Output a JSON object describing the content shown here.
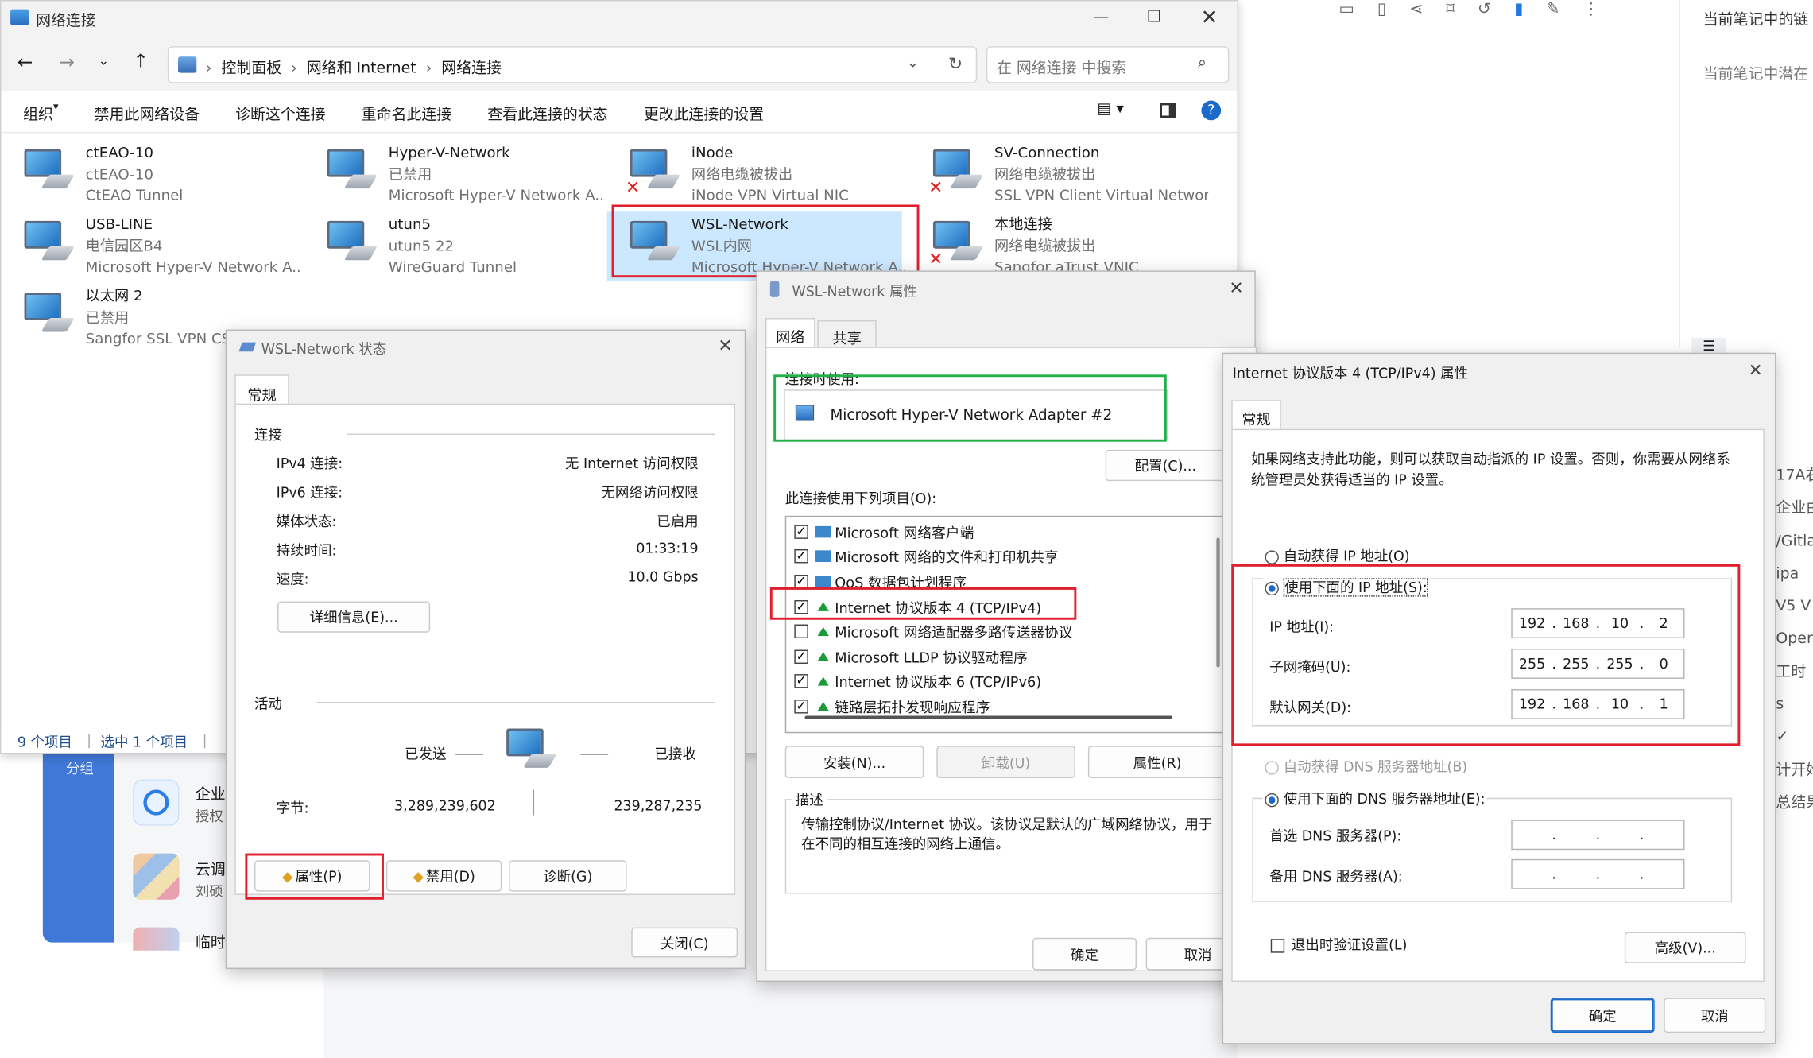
{
  "explorer": {
    "title": "网络连接",
    "breadcrumb": [
      "控制面板",
      "网络和 Internet",
      "网络连接"
    ],
    "search_placeholder": "在 网络连接 中搜索",
    "toolbar": [
      "组织",
      "禁用此网络设备",
      "诊断这个连接",
      "重命名此连接",
      "查看此连接的状态",
      "更改此连接的设置"
    ],
    "items": [
      {
        "name": "ctEAO-10",
        "status": "ctEAO-10",
        "device": "CtEAO Tunnel",
        "error": false
      },
      {
        "name": "Hyper-V-Network",
        "status": "已禁用",
        "device": "Microsoft Hyper-V Network A...",
        "error": false
      },
      {
        "name": "iNode",
        "status": "网络电缆被拔出",
        "device": "iNode VPN Virtual NIC",
        "error": true
      },
      {
        "name": "SV-Connection",
        "status": "网络电缆被拔出",
        "device": "SSL VPN Client Virtual Network...",
        "error": true
      },
      {
        "name": "USB-LINE",
        "status": "电信园区B4",
        "device": "Microsoft Hyper-V Network A...",
        "error": false
      },
      {
        "name": "utun5",
        "status": "utun5 22",
        "device": "WireGuard Tunnel",
        "error": false
      },
      {
        "name": "WSL-Network",
        "status": "WSL内网",
        "device": "Microsoft Hyper-V Network A...",
        "error": false
      },
      {
        "name": "本地连接",
        "status": "网络电缆被拔出",
        "device": "Sangfor aTrust VNIC",
        "error": true
      },
      {
        "name": "以太网 2",
        "status": "已禁用",
        "device": "Sangfor SSL VPN CS",
        "error": false
      }
    ],
    "status_count": "9 个项目",
    "status_selected": "选中 1 个项目"
  },
  "right_panel": {
    "line1": "当前笔记中的链",
    "line2": "当前笔记中潜在",
    "fragments": [
      "17A右",
      "企业由",
      "/Gitla",
      "ipa",
      "V5 V",
      "Oper",
      "工时",
      "s",
      "✓",
      "计开始",
      "总结果"
    ]
  },
  "background_app": {
    "group_label": "分组",
    "rows": [
      {
        "title": "企业",
        "sub": "授权"
      },
      {
        "title": "云调",
        "sub": "刘硕"
      },
      {
        "title": "临时",
        "sub": ""
      }
    ]
  },
  "status_dialog": {
    "title": "WSL-Network 状态",
    "tab": "常规",
    "section_connection": "连接",
    "rows": [
      {
        "label": "IPv4 连接:",
        "value": "无 Internet 访问权限"
      },
      {
        "label": "IPv6 连接:",
        "value": "无网络访问权限"
      },
      {
        "label": "媒体状态:",
        "value": "已启用"
      },
      {
        "label": "持续时间:",
        "value": "01:33:19"
      },
      {
        "label": "速度:",
        "value": "10.0 Gbps"
      }
    ],
    "details_button": "详细信息(E)...",
    "section_activity": "活动",
    "sent_label": "已发送",
    "received_label": "已接收",
    "bytes_label": "字节:",
    "bytes_sent": "3,289,239,602",
    "bytes_received": "239,287,235",
    "properties_button": "属性(P)",
    "disable_button": "禁用(D)",
    "diagnose_button": "诊断(G)",
    "close_button": "关闭(C)"
  },
  "props_dialog": {
    "title": "WSL-Network 属性",
    "tabs": [
      "网络",
      "共享"
    ],
    "connect_using_label": "连接时使用:",
    "adapter": "Microsoft Hyper-V Network Adapter #2",
    "configure_button": "配置(C)...",
    "items_label": "此连接使用下列项目(O):",
    "items": [
      {
        "label": "Microsoft 网络客户端",
        "checked": true,
        "icon": "network-client-icon"
      },
      {
        "label": "Microsoft 网络的文件和打印机共享",
        "checked": true,
        "icon": "network-client-icon"
      },
      {
        "label": "QoS 数据包计划程序",
        "checked": true,
        "icon": "network-client-icon"
      },
      {
        "label": "Internet 协议版本 4 (TCP/IPv4)",
        "checked": true,
        "icon": "protocol-icon"
      },
      {
        "label": "Microsoft 网络适配器多路传送器协议",
        "checked": false,
        "icon": "protocol-icon"
      },
      {
        "label": "Microsoft LLDP 协议驱动程序",
        "checked": true,
        "icon": "protocol-icon"
      },
      {
        "label": "Internet 协议版本 6 (TCP/IPv6)",
        "checked": true,
        "icon": "protocol-icon"
      },
      {
        "label": "链路层拓扑发现响应程序",
        "checked": true,
        "icon": "protocol-icon"
      }
    ],
    "install_button": "安装(N)...",
    "uninstall_button": "卸载(U)",
    "properties_button": "属性(R)",
    "description_label": "描述",
    "description": "传输控制协议/Internet 协议。该协议是默认的广域网络协议，用于在不同的相互连接的网络上通信。",
    "ok_button": "确定",
    "cancel_button": "取消"
  },
  "ipv4_dialog": {
    "title": "Internet 协议版本 4 (TCP/IPv4) 属性",
    "tab": "常规",
    "intro": "如果网络支持此功能，则可以获取自动指派的 IP 设置。否则，你需要从网络系统管理员处获得适当的 IP 设置。",
    "auto_ip": "自动获得 IP 地址(O)",
    "manual_ip": "使用下面的 IP 地址(S):",
    "ip_label": "IP 地址(I):",
    "ip": [
      "192",
      "168",
      "10",
      "2"
    ],
    "mask_label": "子网掩码(U):",
    "mask": [
      "255",
      "255",
      "255",
      "0"
    ],
    "gateway_label": "默认网关(D):",
    "gateway": [
      "192",
      "168",
      "10",
      "1"
    ],
    "auto_dns": "自动获得 DNS 服务器地址(B)",
    "manual_dns": "使用下面的 DNS 服务器地址(E):",
    "dns1_label": "首选 DNS 服务器(P):",
    "dns2_label": "备用 DNS 服务器(A):",
    "dns_dots": [
      ".",
      ".",
      "."
    ],
    "validate_label": "退出时验证设置(L)",
    "advanced_button": "高级(V)...",
    "ok_button": "确定",
    "cancel_button": "取消"
  }
}
